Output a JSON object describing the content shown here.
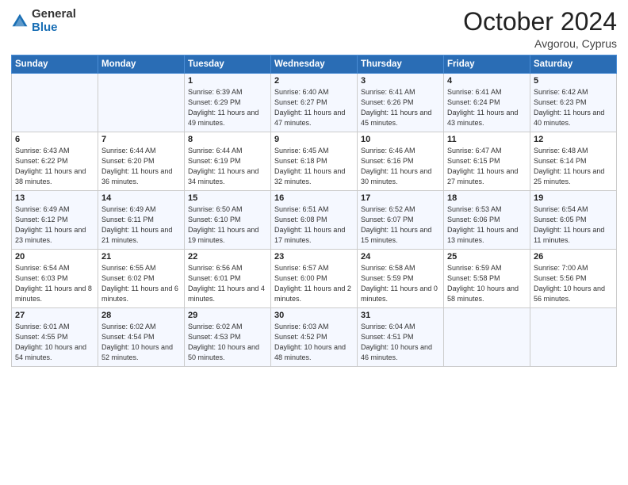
{
  "logo": {
    "general": "General",
    "blue": "Blue"
  },
  "header": {
    "month": "October 2024",
    "location": "Avgorou, Cyprus"
  },
  "days_of_week": [
    "Sunday",
    "Monday",
    "Tuesday",
    "Wednesday",
    "Thursday",
    "Friday",
    "Saturday"
  ],
  "weeks": [
    [
      {
        "day": "",
        "sunrise": "",
        "sunset": "",
        "daylight": ""
      },
      {
        "day": "",
        "sunrise": "",
        "sunset": "",
        "daylight": ""
      },
      {
        "day": "1",
        "sunrise": "Sunrise: 6:39 AM",
        "sunset": "Sunset: 6:29 PM",
        "daylight": "Daylight: 11 hours and 49 minutes."
      },
      {
        "day": "2",
        "sunrise": "Sunrise: 6:40 AM",
        "sunset": "Sunset: 6:27 PM",
        "daylight": "Daylight: 11 hours and 47 minutes."
      },
      {
        "day": "3",
        "sunrise": "Sunrise: 6:41 AM",
        "sunset": "Sunset: 6:26 PM",
        "daylight": "Daylight: 11 hours and 45 minutes."
      },
      {
        "day": "4",
        "sunrise": "Sunrise: 6:41 AM",
        "sunset": "Sunset: 6:24 PM",
        "daylight": "Daylight: 11 hours and 43 minutes."
      },
      {
        "day": "5",
        "sunrise": "Sunrise: 6:42 AM",
        "sunset": "Sunset: 6:23 PM",
        "daylight": "Daylight: 11 hours and 40 minutes."
      }
    ],
    [
      {
        "day": "6",
        "sunrise": "Sunrise: 6:43 AM",
        "sunset": "Sunset: 6:22 PM",
        "daylight": "Daylight: 11 hours and 38 minutes."
      },
      {
        "day": "7",
        "sunrise": "Sunrise: 6:44 AM",
        "sunset": "Sunset: 6:20 PM",
        "daylight": "Daylight: 11 hours and 36 minutes."
      },
      {
        "day": "8",
        "sunrise": "Sunrise: 6:44 AM",
        "sunset": "Sunset: 6:19 PM",
        "daylight": "Daylight: 11 hours and 34 minutes."
      },
      {
        "day": "9",
        "sunrise": "Sunrise: 6:45 AM",
        "sunset": "Sunset: 6:18 PM",
        "daylight": "Daylight: 11 hours and 32 minutes."
      },
      {
        "day": "10",
        "sunrise": "Sunrise: 6:46 AM",
        "sunset": "Sunset: 6:16 PM",
        "daylight": "Daylight: 11 hours and 30 minutes."
      },
      {
        "day": "11",
        "sunrise": "Sunrise: 6:47 AM",
        "sunset": "Sunset: 6:15 PM",
        "daylight": "Daylight: 11 hours and 27 minutes."
      },
      {
        "day": "12",
        "sunrise": "Sunrise: 6:48 AM",
        "sunset": "Sunset: 6:14 PM",
        "daylight": "Daylight: 11 hours and 25 minutes."
      }
    ],
    [
      {
        "day": "13",
        "sunrise": "Sunrise: 6:49 AM",
        "sunset": "Sunset: 6:12 PM",
        "daylight": "Daylight: 11 hours and 23 minutes."
      },
      {
        "day": "14",
        "sunrise": "Sunrise: 6:49 AM",
        "sunset": "Sunset: 6:11 PM",
        "daylight": "Daylight: 11 hours and 21 minutes."
      },
      {
        "day": "15",
        "sunrise": "Sunrise: 6:50 AM",
        "sunset": "Sunset: 6:10 PM",
        "daylight": "Daylight: 11 hours and 19 minutes."
      },
      {
        "day": "16",
        "sunrise": "Sunrise: 6:51 AM",
        "sunset": "Sunset: 6:08 PM",
        "daylight": "Daylight: 11 hours and 17 minutes."
      },
      {
        "day": "17",
        "sunrise": "Sunrise: 6:52 AM",
        "sunset": "Sunset: 6:07 PM",
        "daylight": "Daylight: 11 hours and 15 minutes."
      },
      {
        "day": "18",
        "sunrise": "Sunrise: 6:53 AM",
        "sunset": "Sunset: 6:06 PM",
        "daylight": "Daylight: 11 hours and 13 minutes."
      },
      {
        "day": "19",
        "sunrise": "Sunrise: 6:54 AM",
        "sunset": "Sunset: 6:05 PM",
        "daylight": "Daylight: 11 hours and 11 minutes."
      }
    ],
    [
      {
        "day": "20",
        "sunrise": "Sunrise: 6:54 AM",
        "sunset": "Sunset: 6:03 PM",
        "daylight": "Daylight: 11 hours and 8 minutes."
      },
      {
        "day": "21",
        "sunrise": "Sunrise: 6:55 AM",
        "sunset": "Sunset: 6:02 PM",
        "daylight": "Daylight: 11 hours and 6 minutes."
      },
      {
        "day": "22",
        "sunrise": "Sunrise: 6:56 AM",
        "sunset": "Sunset: 6:01 PM",
        "daylight": "Daylight: 11 hours and 4 minutes."
      },
      {
        "day": "23",
        "sunrise": "Sunrise: 6:57 AM",
        "sunset": "Sunset: 6:00 PM",
        "daylight": "Daylight: 11 hours and 2 minutes."
      },
      {
        "day": "24",
        "sunrise": "Sunrise: 6:58 AM",
        "sunset": "Sunset: 5:59 PM",
        "daylight": "Daylight: 11 hours and 0 minutes."
      },
      {
        "day": "25",
        "sunrise": "Sunrise: 6:59 AM",
        "sunset": "Sunset: 5:58 PM",
        "daylight": "Daylight: 10 hours and 58 minutes."
      },
      {
        "day": "26",
        "sunrise": "Sunrise: 7:00 AM",
        "sunset": "Sunset: 5:56 PM",
        "daylight": "Daylight: 10 hours and 56 minutes."
      }
    ],
    [
      {
        "day": "27",
        "sunrise": "Sunrise: 6:01 AM",
        "sunset": "Sunset: 4:55 PM",
        "daylight": "Daylight: 10 hours and 54 minutes."
      },
      {
        "day": "28",
        "sunrise": "Sunrise: 6:02 AM",
        "sunset": "Sunset: 4:54 PM",
        "daylight": "Daylight: 10 hours and 52 minutes."
      },
      {
        "day": "29",
        "sunrise": "Sunrise: 6:02 AM",
        "sunset": "Sunset: 4:53 PM",
        "daylight": "Daylight: 10 hours and 50 minutes."
      },
      {
        "day": "30",
        "sunrise": "Sunrise: 6:03 AM",
        "sunset": "Sunset: 4:52 PM",
        "daylight": "Daylight: 10 hours and 48 minutes."
      },
      {
        "day": "31",
        "sunrise": "Sunrise: 6:04 AM",
        "sunset": "Sunset: 4:51 PM",
        "daylight": "Daylight: 10 hours and 46 minutes."
      },
      {
        "day": "",
        "sunrise": "",
        "sunset": "",
        "daylight": ""
      },
      {
        "day": "",
        "sunrise": "",
        "sunset": "",
        "daylight": ""
      }
    ]
  ]
}
